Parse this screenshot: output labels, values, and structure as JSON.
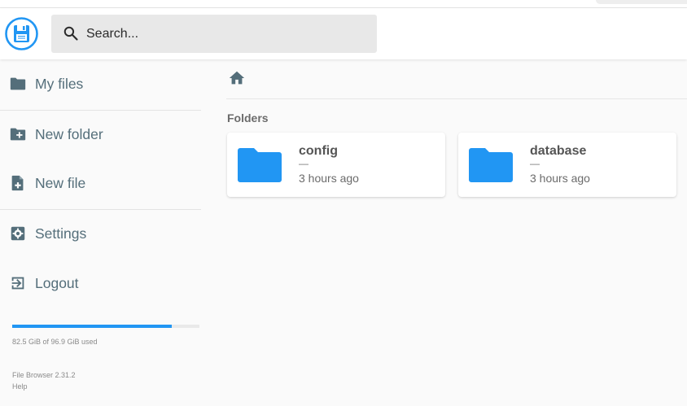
{
  "header": {
    "logo": "floppy-disk-logo",
    "search": {
      "placeholder": "Search..."
    }
  },
  "sidebar": {
    "items": [
      {
        "label": "My files",
        "icon": "folder-icon"
      },
      {
        "label": "New folder",
        "icon": "new-folder-icon"
      },
      {
        "label": "New file",
        "icon": "new-file-icon"
      },
      {
        "label": "Settings",
        "icon": "settings-icon"
      },
      {
        "label": "Logout",
        "icon": "logout-icon"
      }
    ],
    "usage": {
      "text": "82.5 GiB of 96.9 GiB used",
      "used_gib": 82.5,
      "total_gib": 96.9
    },
    "footer": {
      "version": "File Browser 2.31.2",
      "help": "Help"
    }
  },
  "main": {
    "breadcrumb": {
      "icon": "home-icon"
    },
    "section_title": "Folders",
    "folders": [
      {
        "name": "config",
        "size": "—",
        "modified": "3 hours ago"
      },
      {
        "name": "database",
        "size": "—",
        "modified": "3 hours ago"
      }
    ]
  },
  "colors": {
    "accent": "#2196f3",
    "text": "#546e7a",
    "folder": "#2196f3"
  }
}
